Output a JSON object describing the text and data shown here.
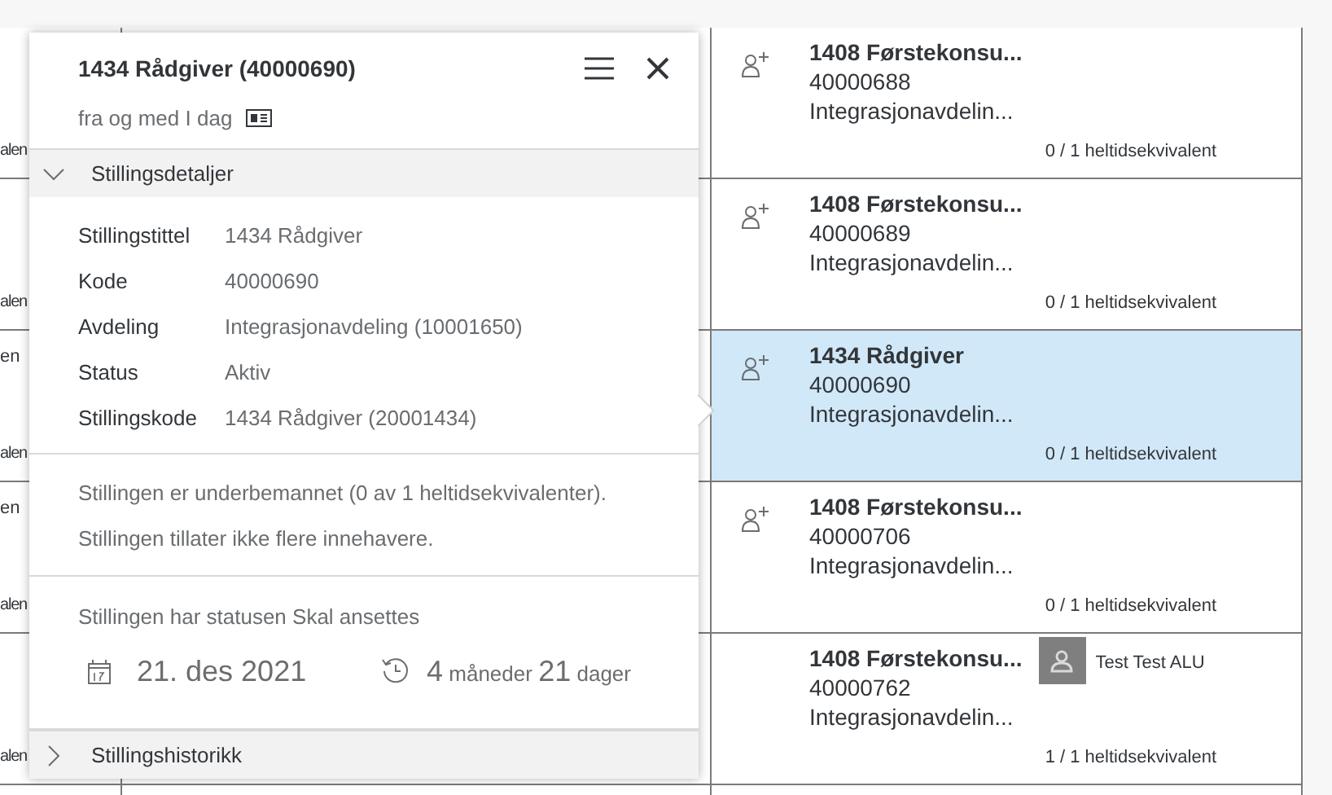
{
  "rows": [
    {
      "column_1": {
        "lower": "alen"
      },
      "title": "1408 Førstekonsu...",
      "code": "40000688",
      "department": "Integrasjonavdelin...",
      "fte": "0 / 1 heltidsekvivalent",
      "selected": false,
      "kind": "vacant"
    },
    {
      "column_1": {
        "lower": "alen"
      },
      "title": "1408 Førstekonsu...",
      "code": "40000689",
      "department": "Integrasjonavdelin...",
      "fte": "0 / 1 heltidsekvivalent",
      "selected": false,
      "kind": "vacant"
    },
    {
      "column_1": {
        "upper": "en",
        "lower": "alen"
      },
      "title": "1434 Rådgiver",
      "code": "40000690",
      "department": "Integrasjonavdelin...",
      "fte": "0 / 1 heltidsekvivalent",
      "selected": true,
      "kind": "vacant"
    },
    {
      "column_1": {
        "upper": "en",
        "lower": "alen"
      },
      "title": "1408 Førstekonsu...",
      "code": "40000706",
      "department": "Integrasjonavdelin...",
      "fte": "0 / 1 heltidsekvivalent",
      "selected": false,
      "kind": "vacant"
    },
    {
      "column_1": {
        "lower": "alen"
      },
      "title": "1408 Førstekonsu...",
      "code": "40000762",
      "department": "Integrasjonavdelin...",
      "fte": "1 / 1 heltidsekvivalent",
      "selected": false,
      "kind": "filled",
      "holder": "Test Test ALU"
    }
  ],
  "popover": {
    "title": "1434 Rådgiver (40000690)",
    "subtitle": "fra og med I dag",
    "details": {
      "title": "Stillingsdetaljer",
      "expanded": true,
      "fields": [
        {
          "label": "Stillingstittel",
          "value": "1434 Rådgiver"
        },
        {
          "label": "Kode",
          "value": "40000690"
        },
        {
          "label": "Avdeling",
          "value": "Integrasjonavdeling (10001650)"
        },
        {
          "label": "Status",
          "value": "Aktiv"
        },
        {
          "label": "Stillingskode",
          "value": "1434 Rådgiver (20001434)"
        }
      ]
    },
    "messages": [
      "Stillingen er underbemannet (0 av 1 heltidsekvivalenter).",
      "Stillingen tillater ikke flere innehavere."
    ],
    "status_text": "Stillingen har statusen Skal ansettes",
    "date": "21. des 2021",
    "duration": {
      "months": "4",
      "months_label": "måneder",
      "days": "21",
      "days_label": "dager"
    },
    "history": {
      "title": "Stillingshistorikk",
      "expanded": false
    }
  }
}
